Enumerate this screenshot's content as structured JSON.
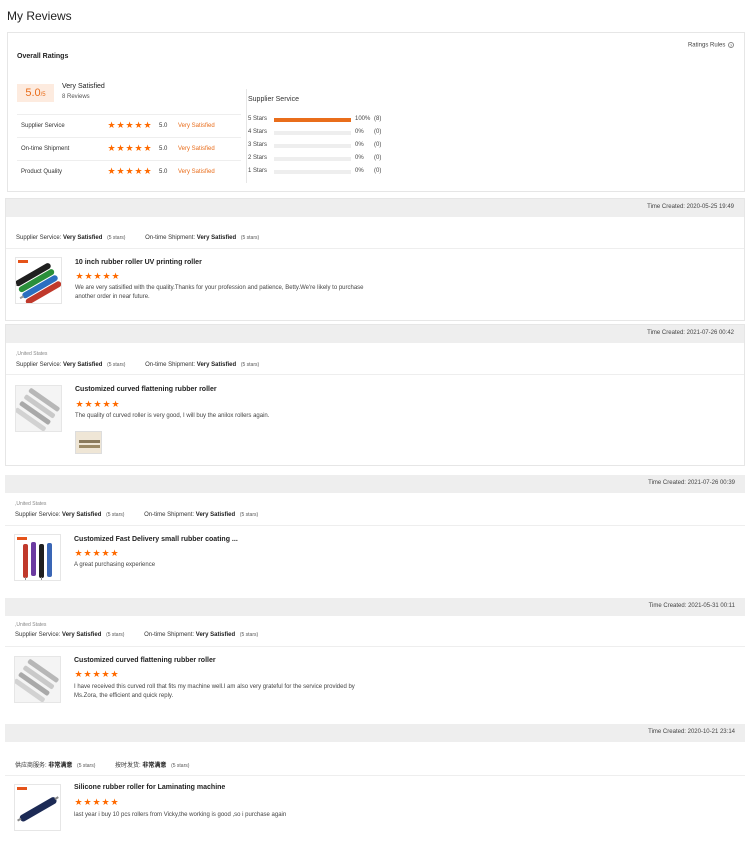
{
  "page": {
    "title": "My Reviews"
  },
  "summary": {
    "title": "Overall Ratings",
    "rules_label": "Ratings Rules",
    "rules_icon": "help-circle-icon",
    "score": "5.0",
    "score_unit": "/5",
    "score_label": "Very Satisfied",
    "review_count": "8 Reviews",
    "metrics": [
      {
        "name": "Supplier Service",
        "stars": 5,
        "score": "5.0",
        "status": "Very Satisfied"
      },
      {
        "name": "On-time Shipment",
        "stars": 5,
        "score": "5.0",
        "status": "Very Satisfied"
      },
      {
        "name": "Product Quality",
        "stars": 5,
        "score": "5.0",
        "status": "Very Satisfied"
      }
    ],
    "distribution": {
      "title": "Supplier Service",
      "rows": [
        {
          "label": "5 Stars",
          "fraction": 1,
          "percent": "100%",
          "count": "(8)"
        },
        {
          "label": "4 Stars",
          "fraction": 0,
          "percent": "0%",
          "count": "(0)"
        },
        {
          "label": "3 Stars",
          "fraction": 0,
          "percent": "0%",
          "count": "(0)"
        },
        {
          "label": "2 Stars",
          "fraction": 0,
          "percent": "0%",
          "count": "(0)"
        },
        {
          "label": "1 Stars",
          "fraction": 0,
          "percent": "0%",
          "count": "(0)"
        }
      ]
    }
  },
  "colors": {
    "accent": "#ff6a00",
    "status": "#e96d1b",
    "header_bg": "#eeeeee"
  },
  "reviews": [
    {
      "time": "Time Created: 2020-05-25 19:49",
      "country": "",
      "service_label": "Supplier Service:",
      "service_value": "Very Satisfied",
      "service_stars": "(5 stars)",
      "shipment_label": "On-time Shipment:",
      "shipment_value": "Very Satisfied",
      "shipment_stars": "(5 stars)",
      "product_title": "10 inch rubber roller UV printing roller",
      "stars": 5,
      "text": "We are very satisified with the quality.Thanks for your profession and patience, Betty.We're likely to purchase another order in near future."
    },
    {
      "time": "Time Created: 2021-07-26 00:42",
      "country": ",United States",
      "service_label": "Supplier Service:",
      "service_value": "Very Satisfied",
      "service_stars": "(5 stars)",
      "shipment_label": "On-time Shipment:",
      "shipment_value": "Very Satisfied",
      "shipment_stars": "(5 stars)",
      "product_title": "Customized curved flattening rubber roller",
      "stars": 5,
      "text": "The quality of curved roller is very good, I will buy the anilox rollers again."
    },
    {
      "time": "Time Created: 2021-07-26 00:39",
      "country": ",United States",
      "service_label": "Supplier Service:",
      "service_value": "Very Satisfied",
      "service_stars": "(5 stars)",
      "shipment_label": "On-time Shipment:",
      "shipment_value": "Very Satisfied",
      "shipment_stars": "(5 stars)",
      "product_title": "Customized Fast Delivery small rubber coating ...",
      "stars": 5,
      "text": "A great purchasing experience"
    },
    {
      "time": "Time Created: 2021-05-31 00:11",
      "country": ",United States",
      "service_label": "Supplier Service:",
      "service_value": "Very Satisfied",
      "service_stars": "(5 stars)",
      "shipment_label": "On-time Shipment:",
      "shipment_value": "Very Satisfied",
      "shipment_stars": "(5 stars)",
      "product_title": "Customized curved flattening rubber roller",
      "stars": 5,
      "text": "I have received this curved roll that fits my machine well.I am also very grateful for the service provided by Ms.Zora, the efficient and quick reply."
    },
    {
      "time": "Time Created: 2020-10-21 23:14",
      "country": "",
      "service_label": "供应商服务:",
      "service_value": "非常满意",
      "service_stars": "(5 stars)",
      "shipment_label": "按时发货:",
      "shipment_value": "非常满意",
      "shipment_stars": "(5 stars)",
      "product_title": "Silicone rubber roller for Laminating machine",
      "stars": 5,
      "text": "last year i buy 10 pcs rollers from Vicky,the working is good ,so i purchase again"
    }
  ]
}
